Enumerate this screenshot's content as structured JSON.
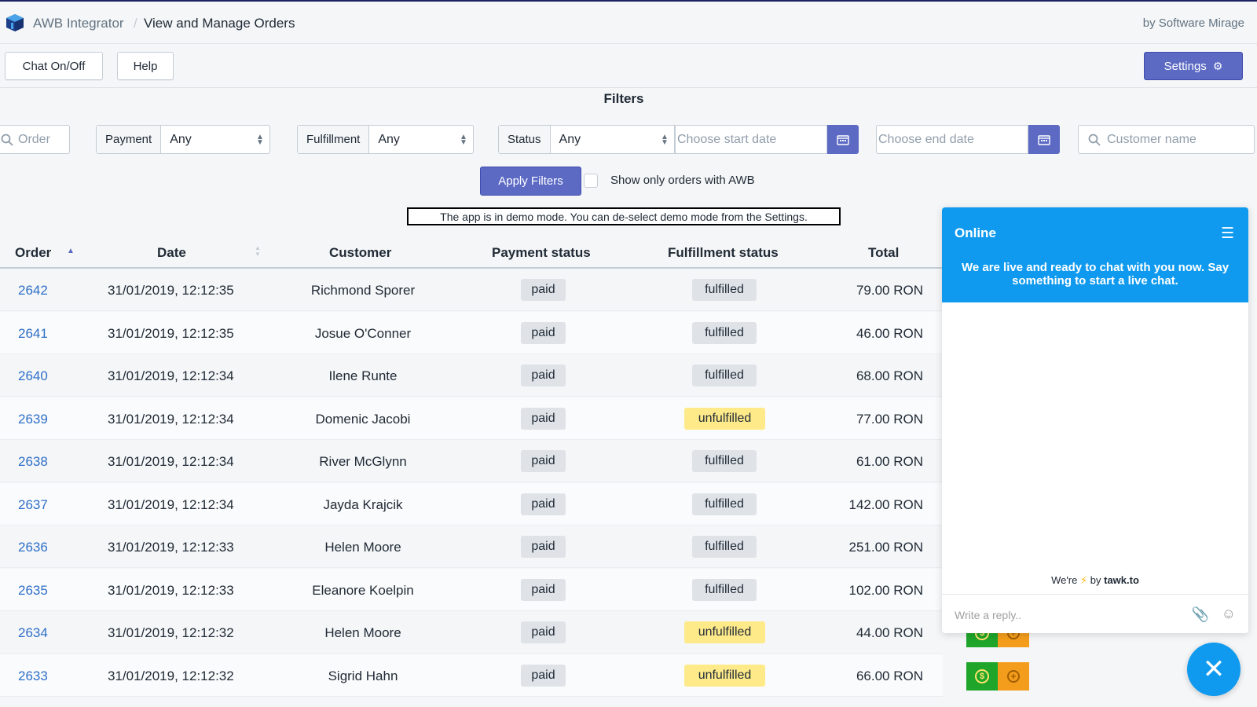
{
  "header": {
    "app_name": "AWB Integrator",
    "separator": "/",
    "page_title": "View and Manage Orders",
    "byline": "by Software Mirage"
  },
  "toolbar": {
    "chat_label": "Chat On/Off",
    "help_label": "Help",
    "settings_label": "Settings"
  },
  "filters": {
    "title": "Filters",
    "order_placeholder": "Order",
    "payment_label": "Payment",
    "payment_value": "Any",
    "fulfillment_label": "Fulfillment",
    "fulfillment_value": "Any",
    "status_label": "Status",
    "status_value": "Any",
    "start_date_placeholder": "Choose start date",
    "end_date_placeholder": "Choose end date",
    "customer_placeholder": "Customer name",
    "apply_label": "Apply Filters",
    "awb_only_label": "Show only orders with AWB"
  },
  "demo_notice": "The app is in demo mode. You can de-select demo mode from the Settings.",
  "table": {
    "columns": [
      "Order",
      "Date",
      "Customer",
      "Payment status",
      "Fulfillment status",
      "Total"
    ],
    "rows": [
      {
        "order": "2642",
        "date": "31/01/2019, 12:12:35",
        "customer": "Richmond Sporer",
        "payment": "paid",
        "fulfillment": "fulfilled",
        "total": "79.00 RON"
      },
      {
        "order": "2641",
        "date": "31/01/2019, 12:12:35",
        "customer": "Josue O'Conner",
        "payment": "paid",
        "fulfillment": "fulfilled",
        "total": "46.00 RON"
      },
      {
        "order": "2640",
        "date": "31/01/2019, 12:12:34",
        "customer": "Ilene Runte",
        "payment": "paid",
        "fulfillment": "fulfilled",
        "total": "68.00 RON"
      },
      {
        "order": "2639",
        "date": "31/01/2019, 12:12:34",
        "customer": "Domenic Jacobi",
        "payment": "paid",
        "fulfillment": "unfulfilled",
        "total": "77.00 RON"
      },
      {
        "order": "2638",
        "date": "31/01/2019, 12:12:34",
        "customer": "River McGlynn",
        "payment": "paid",
        "fulfillment": "fulfilled",
        "total": "61.00 RON"
      },
      {
        "order": "2637",
        "date": "31/01/2019, 12:12:34",
        "customer": "Jayda Krajcik",
        "payment": "paid",
        "fulfillment": "fulfilled",
        "total": "142.00 RON"
      },
      {
        "order": "2636",
        "date": "31/01/2019, 12:12:33",
        "customer": "Helen Moore",
        "payment": "paid",
        "fulfillment": "fulfilled",
        "total": "251.00 RON"
      },
      {
        "order": "2635",
        "date": "31/01/2019, 12:12:33",
        "customer": "Eleanore Koelpin",
        "payment": "paid",
        "fulfillment": "fulfilled",
        "total": "102.00 RON"
      },
      {
        "order": "2634",
        "date": "31/01/2019, 12:12:32",
        "customer": "Helen Moore",
        "payment": "paid",
        "fulfillment": "unfulfilled",
        "total": "44.00 RON"
      },
      {
        "order": "2633",
        "date": "31/01/2019, 12:12:32",
        "customer": "Sigrid Hahn",
        "payment": "paid",
        "fulfillment": "unfulfilled",
        "total": "66.00 RON"
      }
    ]
  },
  "chat": {
    "status": "Online",
    "message": "We are live and ready to chat with you now. Say something to start a live chat.",
    "powered_prefix": "We're",
    "powered_suffix": "by",
    "powered_brand": "tawk.to",
    "reply_placeholder": "Write a reply.."
  },
  "colors": {
    "accent": "#5c6ac4",
    "link": "#2f6fc7",
    "chat_blue": "#0f9aef",
    "unfulfilled": "#ffea8a"
  },
  "icons": {
    "logo": "cube-logo-icon",
    "settings": "gear-icon",
    "search": "search-icon",
    "calendar": "calendar-icon",
    "chat_menu": "hamburger-menu-icon",
    "chat_close": "close-icon"
  }
}
